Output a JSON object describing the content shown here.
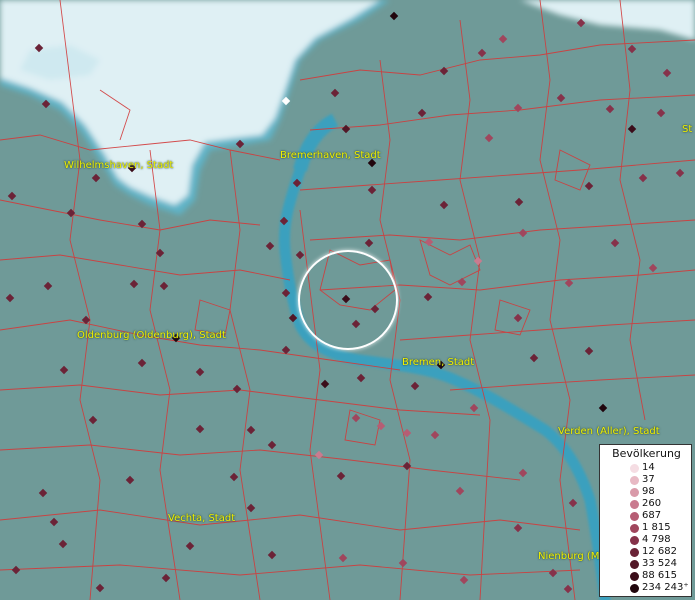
{
  "labels": {
    "wilhelmshaven": "Wilhelmshaven, Stadt",
    "bremerhaven": "Bremerhaven, Stadt",
    "oldenburg": "Oldenburg (Oldenburg), Stadt",
    "bremen": "Bremen, Stadt",
    "verden": "Verden (Aller), Stadt",
    "vechta": "Vechta, Stadt",
    "nienburg": "Nienburg (M",
    "edge_fragment": "St"
  },
  "legend": {
    "title": "Bevölkerung",
    "items": [
      {
        "label": "14",
        "color": "#f5dde3"
      },
      {
        "label": "37",
        "color": "#e8b9c4"
      },
      {
        "label": "98",
        "color": "#d99aa9"
      },
      {
        "label": "260",
        "color": "#c97b8f"
      },
      {
        "label": "687",
        "color": "#b65d74"
      },
      {
        "label": "1 815",
        "color": "#a0465d"
      },
      {
        "label": "4 798",
        "color": "#86324a"
      },
      {
        "label": "12 682",
        "color": "#6b2337"
      },
      {
        "label": "33 524",
        "color": "#521727"
      },
      {
        "label": "88 615",
        "color": "#3b0d1a"
      },
      {
        "label": "234 243⁺",
        "color": "#21060d"
      }
    ]
  },
  "colors": {
    "land": "#6f9a98",
    "sea": "#dff0f4",
    "river": "#3aa0be",
    "boundary": "#d23a3a",
    "label": "#f2f200"
  }
}
